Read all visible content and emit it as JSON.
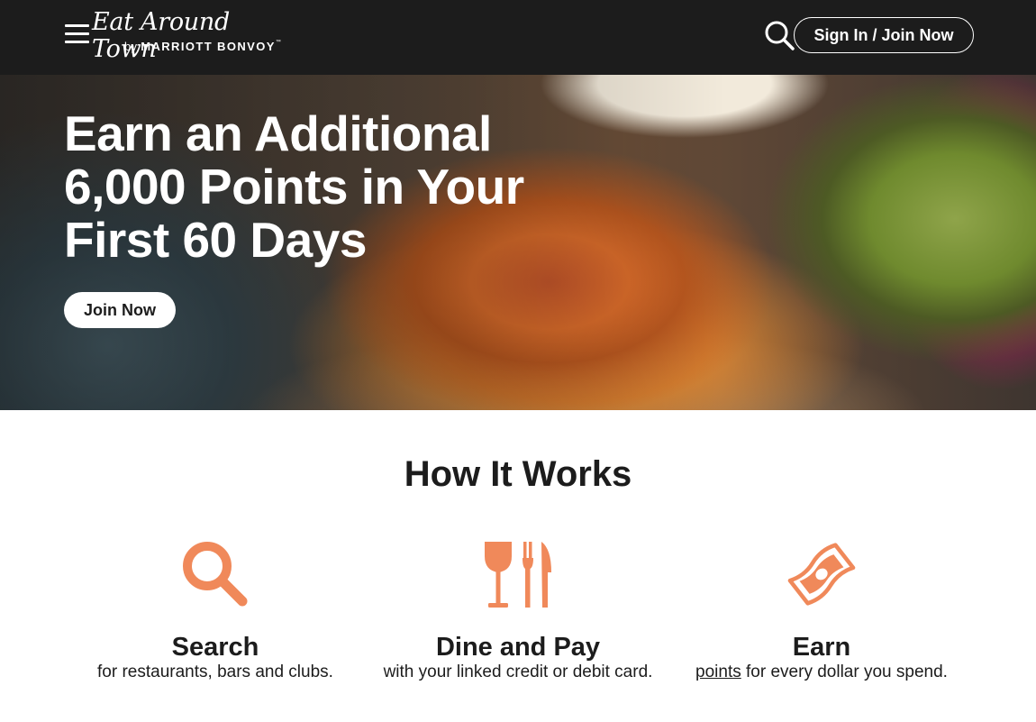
{
  "header": {
    "logo_main": "Eat Around Town",
    "logo_by": "by ",
    "logo_brand": "MARRIOTT BONVOY",
    "logo_tm": "™",
    "signin_label": "Sign In / Join Now"
  },
  "hero": {
    "title": "Earn an Additional 6,000 Points in Your First 60 Days",
    "cta_label": "Join Now"
  },
  "how_it_works": {
    "title": "How It Works",
    "steps": [
      {
        "icon": "magnifier-icon",
        "title": "Search",
        "desc": "for restaurants, bars and clubs."
      },
      {
        "icon": "wine-fork-knife-icon",
        "title": "Dine and Pay",
        "desc": "with your linked credit or debit card."
      },
      {
        "icon": "cash-bill-icon",
        "title": "Earn",
        "desc_link": "points",
        "desc_rest": " for every dollar you spend."
      }
    ]
  },
  "colors": {
    "header_bg": "#1c1c1c",
    "icon_accent": "#f0895a",
    "text": "#1c1c1c"
  }
}
